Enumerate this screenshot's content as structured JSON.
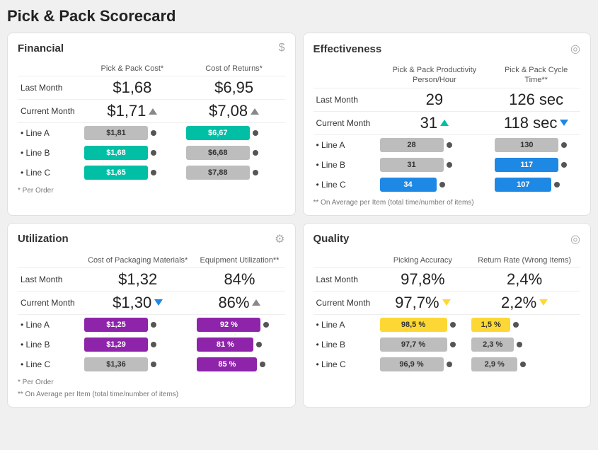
{
  "title": "Pick & Pack Scorecard",
  "financial": {
    "title": "Financial",
    "col1": "Pick & Pack Cost*",
    "col2": "Cost of Returns*",
    "lastMonth": {
      "label": "Last Month",
      "v1": "$1,68",
      "v2": "$6,95"
    },
    "currentMonth": {
      "label": "Current Month",
      "v1": "$1,71",
      "v2": "$7,08",
      "v1Arrow": "up-gray",
      "v2Arrow": "up-gray"
    },
    "lines": [
      {
        "label": "• Line A",
        "v1": "$1,81",
        "v1Color": "gray",
        "v2": "$6,67",
        "v2Color": "teal"
      },
      {
        "label": "• Line B",
        "v1": "$1,68",
        "v1Color": "teal",
        "v2": "$6,68",
        "v2Color": "gray"
      },
      {
        "label": "• Line C",
        "v1": "$1,65",
        "v1Color": "teal",
        "v2": "$7,88",
        "v2Color": "gray"
      }
    ],
    "note": "* Per Order"
  },
  "effectiveness": {
    "title": "Effectiveness",
    "col1": "Pick & Pack Productivity Person/Hour",
    "col2": "Pick & Pack Cycle Time**",
    "lastMonth": {
      "label": "Last Month",
      "v1": "29",
      "v2": "126 sec"
    },
    "currentMonth": {
      "label": "Current Month",
      "v1": "31",
      "v2": "118 sec",
      "v1Arrow": "up-teal",
      "v2Arrow": "down-blue"
    },
    "lines": [
      {
        "label": "• Line A",
        "v1": "28",
        "v1Color": "gray",
        "v2": "130",
        "v2Color": "gray"
      },
      {
        "label": "• Line B",
        "v1": "31",
        "v1Color": "gray",
        "v2": "117",
        "v2Color": "blue"
      },
      {
        "label": "• Line C",
        "v1": "34",
        "v1Color": "blue",
        "v2": "107",
        "v2Color": "blue"
      }
    ],
    "note": "** On Average per Item (total time/number of items)"
  },
  "utilization": {
    "title": "Utilization",
    "col1": "Cost of Packaging Materials*",
    "col2": "Equipment Utilization**",
    "lastMonth": {
      "label": "Last Month",
      "v1": "$1,32",
      "v2": "84%"
    },
    "currentMonth": {
      "label": "Current Month",
      "v1": "$1,30",
      "v2": "86%",
      "v1Arrow": "down-blue",
      "v2Arrow": "up-gray"
    },
    "lines": [
      {
        "label": "• Line A",
        "v1": "$1,25",
        "v1Color": "purple",
        "v2": "92 %",
        "v2Color": "purple"
      },
      {
        "label": "• Line B",
        "v1": "$1,29",
        "v1Color": "purple",
        "v2": "81 %",
        "v2Color": "purple"
      },
      {
        "label": "• Line C",
        "v1": "$1,36",
        "v1Color": "gray",
        "v2": "85 %",
        "v2Color": "purple"
      }
    ],
    "note1": "* Per Order",
    "note2": "** On Average per Item (total time/number of items)"
  },
  "quality": {
    "title": "Quality",
    "col1": "Picking Accuracy",
    "col2": "Return Rate (Wrong Items)",
    "lastMonth": {
      "label": "Last Month",
      "v1": "97,8%",
      "v2": "2,4%"
    },
    "currentMonth": {
      "label": "Current Month",
      "v1": "97,7%",
      "v2": "2,2%",
      "v1Arrow": "down-yellow",
      "v2Arrow": "down-yellow"
    },
    "lines": [
      {
        "label": "• Line A",
        "v1": "98,5 %",
        "v1Color": "yellow",
        "v2": "1,5 %",
        "v2Color": "yellow"
      },
      {
        "label": "• Line B",
        "v1": "97,7 %",
        "v1Color": "gray",
        "v2": "2,3 %",
        "v2Color": "gray"
      },
      {
        "label": "• Line C",
        "v1": "96,9 %",
        "v1Color": "gray",
        "v2": "2,9 %",
        "v2Color": "gray"
      }
    ]
  }
}
